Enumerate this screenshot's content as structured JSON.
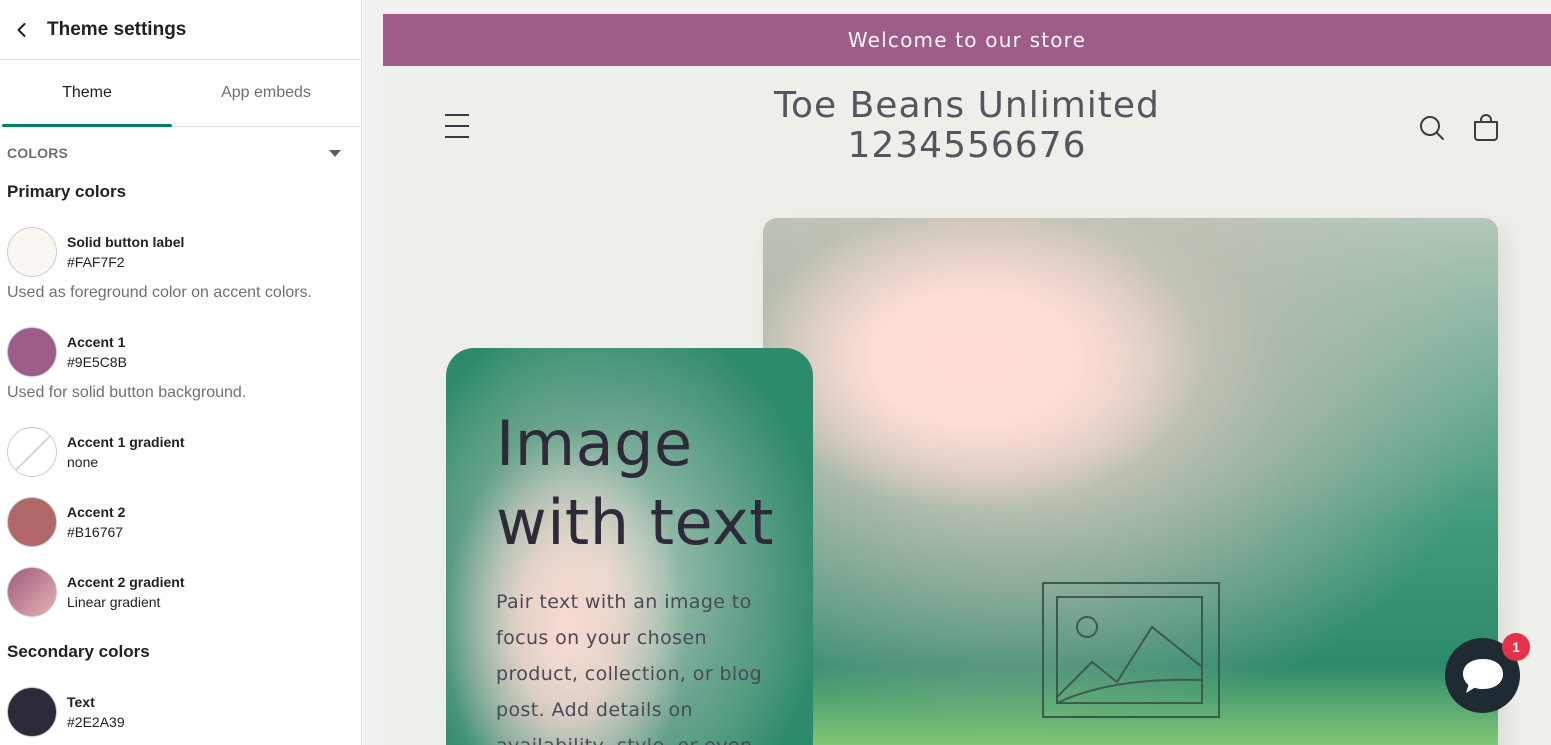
{
  "sidebar": {
    "title": "Theme settings",
    "tabs": [
      {
        "label": "Theme"
      },
      {
        "label": "App embeds"
      }
    ],
    "section": {
      "label": "COLORS"
    },
    "primary_title": "Primary colors",
    "secondary_title": "Secondary colors",
    "swatches": [
      {
        "name": "Solid button label",
        "value": "#FAF7F2",
        "color": "#FAF7F2"
      },
      {
        "name": "Accent 1",
        "value": "#9E5C8B",
        "color": "#9E5C8B"
      },
      {
        "name": "Accent 1 gradient",
        "value": "none",
        "color": "none"
      },
      {
        "name": "Accent 2",
        "value": "#B16767",
        "color": "#B16767"
      },
      {
        "name": "Accent 2 gradient",
        "value": "Linear gradient",
        "color": "linear-gradient(135deg, #a0597f, #e3b4b2)"
      },
      {
        "name": "Text",
        "value": "#2E2A39",
        "color": "#2E2A39"
      }
    ],
    "help_solid": "Used as foreground color on accent colors.",
    "help_accent1": "Used for solid button background."
  },
  "store": {
    "announcement": "Welcome to our store",
    "name_line1": "Toe Beans Unlimited",
    "name_line2": "1234556676",
    "card_heading_line1": "Image",
    "card_heading_line2": "with text",
    "card_body": "Pair text with an image to focus on your chosen product, collection, or blog post. Add details on availability, style, or even",
    "chat_badge": "1"
  },
  "icons": {
    "back": "chevron-left-icon",
    "caret": "caret-down-icon",
    "menu": "hamburger-menu-icon",
    "search": "search-icon",
    "cart": "cart-icon",
    "placeholder": "image-placeholder-icon",
    "chat": "chat-bubble-icon"
  },
  "colors": {
    "tab_active": "#008060",
    "announcement_bg": "#9E5C8B",
    "store_bg": "#EFEFE9",
    "chat_badge": "#E3334A"
  }
}
